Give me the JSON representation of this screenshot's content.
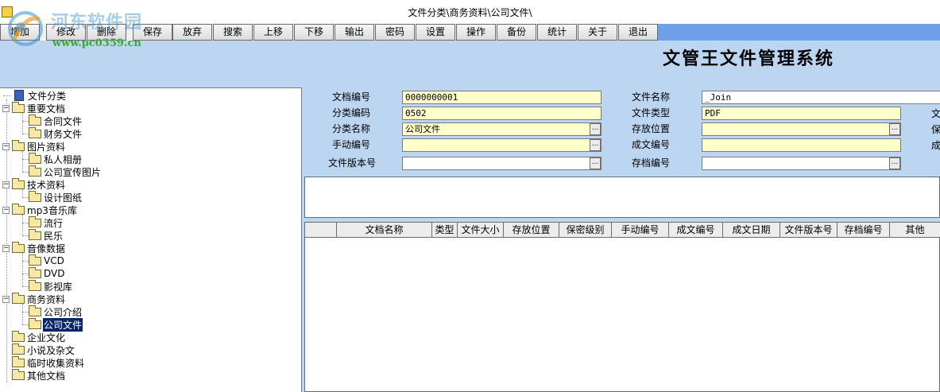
{
  "window": {
    "title": "文件分类\\商务资料\\公司文件\\"
  },
  "watermark": {
    "name": "河东软件园",
    "url": "www.pc0359.cn"
  },
  "toolbar": {
    "buttons": [
      "增加",
      "修改",
      "删除",
      "保存",
      "放弃",
      "搜索",
      "上移",
      "下移",
      "输出",
      "密码",
      "设置",
      "操作",
      "备份",
      "统计",
      "关于",
      "退出"
    ]
  },
  "app_title": "文管王文件管理系统",
  "tree": {
    "root": "文件分类",
    "nodes": [
      {
        "label": "重要文档",
        "children": [
          "合同文件",
          "财务文件"
        ]
      },
      {
        "label": "图片资料",
        "children": [
          "私人相册",
          "公司宣传图片"
        ]
      },
      {
        "label": "技术资料",
        "children": [
          "设计图纸"
        ]
      },
      {
        "label": "mp3音乐库",
        "children": [
          "流行",
          "民乐"
        ]
      },
      {
        "label": "音像数据",
        "children": [
          "VCD",
          "DVD",
          "影视库"
        ]
      },
      {
        "label": "商务资料",
        "children": [
          "公司介绍",
          "公司文件"
        ]
      },
      {
        "label": "企业文化",
        "children": []
      },
      {
        "label": "小说及杂文",
        "children": []
      },
      {
        "label": "临时收集资料",
        "children": []
      },
      {
        "label": "其他文档",
        "children": []
      }
    ],
    "selected": "公司文件"
  },
  "form": {
    "doc_no": {
      "label": "文档编号",
      "value": "0000000001"
    },
    "cat_code": {
      "label": "分类编码",
      "value": "0502"
    },
    "cat_name": {
      "label": "分类名称",
      "value": "公司文件"
    },
    "manual_no": {
      "label": "手动编号",
      "value": ""
    },
    "version_no": {
      "label": "文件版本号",
      "value": ""
    },
    "file_name": {
      "label": "文件名称",
      "value": "_Join"
    },
    "file_type": {
      "label": "文件类型",
      "value": "PDF"
    },
    "location": {
      "label": "存放位置",
      "value": ""
    },
    "doc_code": {
      "label": "成文编号",
      "value": ""
    },
    "archive_no": {
      "label": "存档编号",
      "value": ""
    },
    "edge_labels": [
      "文",
      "保",
      "成"
    ],
    "ellipsis": "..."
  },
  "grid": {
    "columns": [
      "",
      "文档名称",
      "类型",
      "文件大小",
      "存放位置",
      "保密级别",
      "手动编号",
      "成文编号",
      "成文日期",
      "文件版本号",
      "存档编号",
      "其他"
    ],
    "rows": []
  }
}
